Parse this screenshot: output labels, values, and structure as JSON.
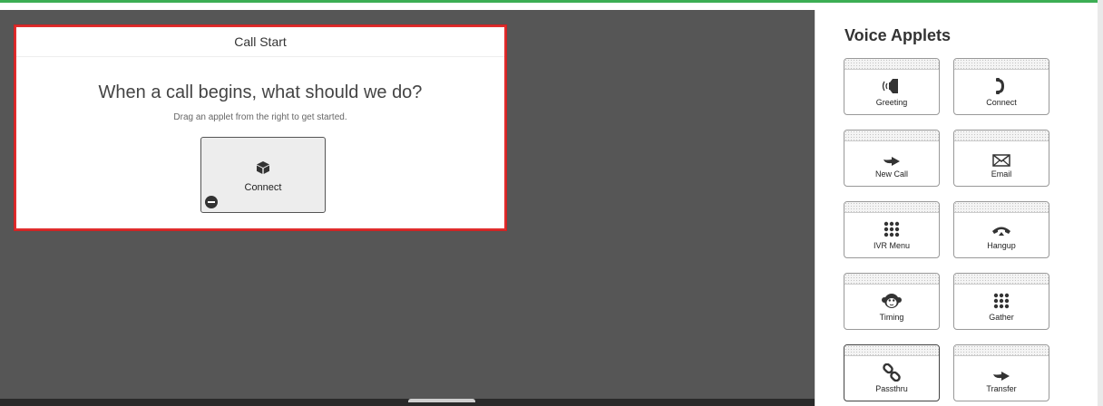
{
  "flow": {
    "header": "Call Start",
    "question": "When a call begins, what should we do?",
    "hint": "Drag an applet from the right to get started.",
    "dropped_applet": {
      "label": "Connect",
      "icon": "box-icon"
    }
  },
  "sidebar": {
    "title": "Voice Applets",
    "applets": [
      {
        "label": "Greeting",
        "icon": "greeting-speaker-icon"
      },
      {
        "label": "Connect",
        "icon": "phone-handset-icon"
      },
      {
        "label": "New Call",
        "icon": "arrow-icon"
      },
      {
        "label": "Email",
        "icon": "envelope-icon"
      },
      {
        "label": "IVR Menu",
        "icon": "keypad-icon"
      },
      {
        "label": "Hangup",
        "icon": "hangup-phone-icon"
      },
      {
        "label": "Timing",
        "icon": "monkey-icon"
      },
      {
        "label": "Gather",
        "icon": "keypad-icon"
      },
      {
        "label": "Passthru",
        "icon": "chain-link-icon"
      },
      {
        "label": "Transfer",
        "icon": "arrow-icon"
      }
    ]
  },
  "colors": {
    "accent": "#3cae54",
    "selected_border": "#e02d2d",
    "canvas": "#565656"
  }
}
